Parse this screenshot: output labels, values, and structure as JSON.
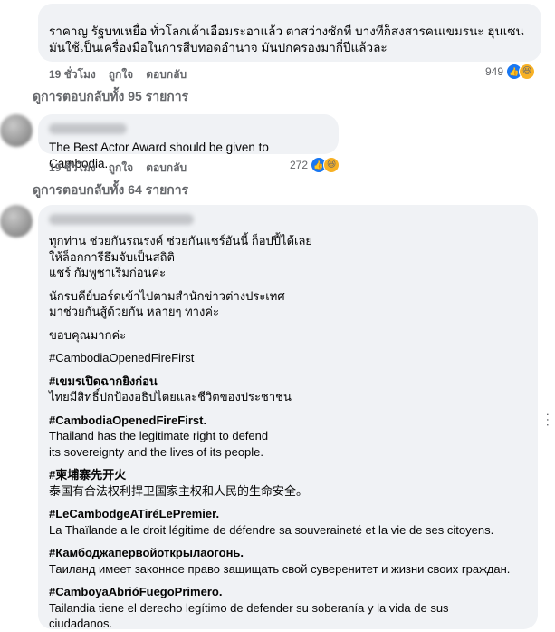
{
  "comments": [
    {
      "text": "ราคาญ รัฐบทเหยื่อ ทั่วโลกเค้าเอือมระอาแล้ว ตาสว่างซักที บางทีก็สงสารคนเขมรนะ ฮุนเซนมันใช้เป็นเครื่องมือในการสืบทอดอำนาจ มันปกครองมากี่ปีแล้วละ",
      "time": "19 ชั่วโมง",
      "like": "ถูกใจ",
      "reply": "ตอบกลับ",
      "reaction_count": "949",
      "replies": "ดูการตอบกลับทั้ง 95 รายการ"
    },
    {
      "text": "The Best Actor Award should be given to Cambodia.",
      "time": "19 ชั่วโมง",
      "like": "ถูกใจ",
      "reply": "ตอบกลับ",
      "reaction_count": "272",
      "replies": "ดูการตอบกลับทั้ง 64 รายการ"
    }
  ],
  "long_comment": {
    "p1": "ทุกท่าน ช่วยกันรณรงค์ ช่วยกันแชร์อันนี้ ก็อปปี้ได้เลย\nให้ล็อกการีธึมจับเป็นสถิติ\nแชร์ กัมพูชาเริ่มก่อนค่ะ",
    "p2": "นักรบคีย์บอร์ดเข้าไปตามสำนักข่าวต่างประเทศ\nมาช่วยกันสู้ด้วยกัน หลายๆ ทางค่ะ",
    "p3": "ขอบคุณมากค่ะ",
    "hashtag_plain": "#CambodiaOpenedFireFirst",
    "items": [
      {
        "tag": "#เขมรเปิดฉากยิงก่อน",
        "body": "ไทยมีสิทธิ์ปกป้องอธิปไตยและชีวิตของประชาชน"
      },
      {
        "tag": "#CambodiaOpenedFireFirst.",
        "body": "Thailand has the legitimate right to defend\nits sovereignty and the lives of its people."
      },
      {
        "tag": "#柬埔寨先开火",
        "body": "泰国有合法权利捍卫国家主权和人民的生命安全。"
      },
      {
        "tag": "#LeCambodgeATiréLePremier.",
        "body": "La Thaïlande a le droit légitime de défendre sa souveraineté et la vie de ses citoyens."
      },
      {
        "tag": "#Камбоджапервойоткрылаогонь.",
        "body": "Таиланд имеет законное право защищать свой суверенитет и жизни своих граждан."
      },
      {
        "tag": "#CamboyaAbrióFuegoPrimero.",
        "body": "Tailandia tiene el derecho legítimo de defender su soberanía y la vida de sus\nciudadanos."
      }
    ]
  },
  "colors": {
    "bubble": "#f0f2f5",
    "meta": "#65676b",
    "like_blue": "#1877f2",
    "haha_yellow": "#f7b125"
  },
  "icons": [
    "like-reaction-icon",
    "haha-reaction-icon",
    "more-options-icon",
    "reply-arrow-icon"
  ]
}
